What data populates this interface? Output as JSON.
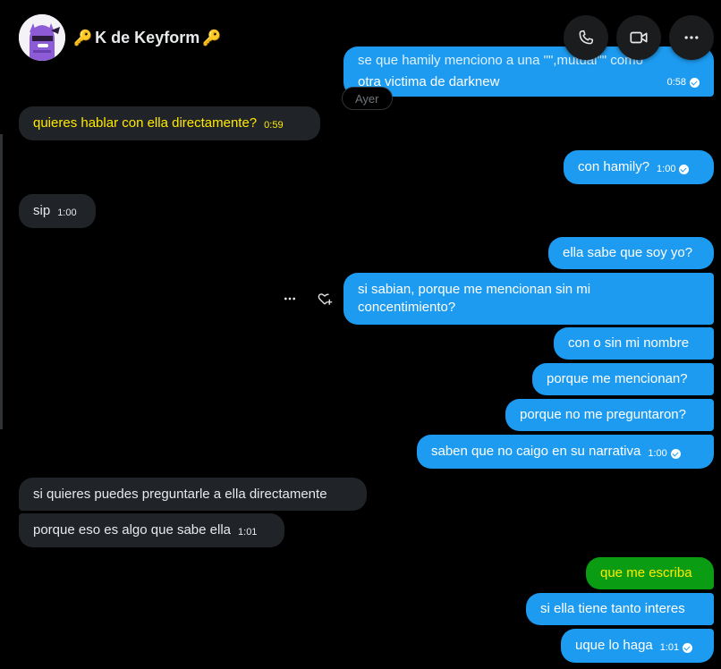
{
  "header": {
    "name": "K de Keyform",
    "key_emoji": "🔑",
    "call_icon": "phone-icon",
    "video_icon": "video-icon",
    "more_icon": "more-icon"
  },
  "date_separator": "Ayer",
  "messages": [
    {
      "side": "out",
      "lines": [
        "se que hamily menciono a una \"\",mutual\"\" como",
        "otra victima de darknew"
      ],
      "time": "0:58"
    },
    {
      "side": "in",
      "text": "quieres hablar con ella directamente?",
      "time": "0:59"
    },
    {
      "side": "out",
      "text": "con hamily?",
      "time": "1:00"
    },
    {
      "side": "in",
      "text": "sip",
      "time": "1:00"
    },
    {
      "side": "out",
      "text": "ella sabe que soy yo?"
    },
    {
      "side": "out",
      "lines": [
        "si sabian, porque me mencionan sin mi",
        "concentimiento?"
      ]
    },
    {
      "side": "out",
      "text": "con o sin mi nombre"
    },
    {
      "side": "out",
      "text": "porque me mencionan?"
    },
    {
      "side": "out",
      "text": "porque no me preguntaron?"
    },
    {
      "side": "out",
      "text": "saben que no caigo en su narrativa",
      "time": "1:00"
    },
    {
      "side": "in",
      "text": "si quieres puedes preguntarle a ella directamente"
    },
    {
      "side": "in",
      "text": "porque eso es algo que sabe ella",
      "time": "1:01"
    },
    {
      "side": "out",
      "text": "que me escriba"
    },
    {
      "side": "out",
      "text": "si ella tiene tanto interes"
    },
    {
      "side": "out",
      "text": "uque lo haga",
      "time": "1:01"
    }
  ],
  "hover_actions": {
    "more": "more-options-icon",
    "react": "heart-plus-icon"
  },
  "colors": {
    "outgoing": "#1d9bf0",
    "incoming": "#202327",
    "highlight_yellow": "#ffea00",
    "highlight_green": "#0a9d14"
  }
}
